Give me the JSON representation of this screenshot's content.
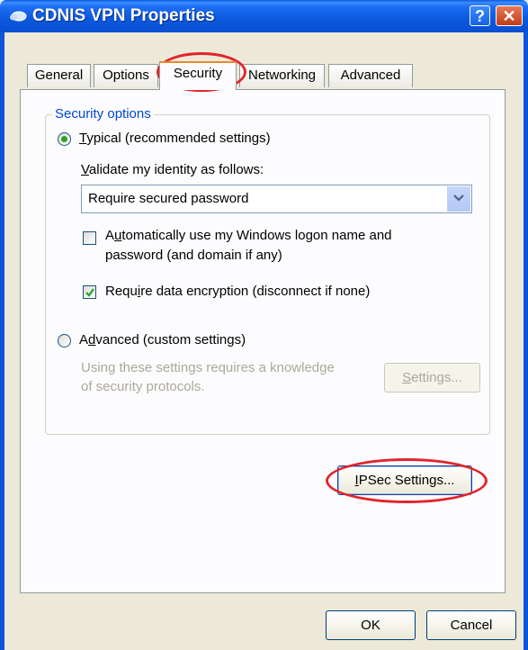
{
  "window": {
    "title": "CDNIS VPN Properties",
    "help": "?",
    "close": "✕"
  },
  "tabs": [
    "General",
    "Options",
    "Security",
    "Networking",
    "Advanced"
  ],
  "security_options": {
    "legend": "Security options",
    "typical": {
      "pre": "",
      "accel": "T",
      "post": "ypical (recommended settings)",
      "selected": true
    },
    "validate": {
      "pre": "",
      "accel": "V",
      "post": "alidate my identity as follows:"
    },
    "identity_select": {
      "value": "Require secured password"
    },
    "auto_logon": {
      "pre": "A",
      "accel": "u",
      "post": "tomatically use my Windows logon name and",
      "line2": "password (and domain if any)",
      "checked": false
    },
    "encrypt": {
      "pre": "Requ",
      "accel": "i",
      "post": "re data encryption (disconnect if none)",
      "checked": true
    },
    "advanced": {
      "pre": "A",
      "accel": "d",
      "post": "vanced (custom settings)",
      "selected": false
    },
    "advanced_note": {
      "line1": "Using these settings requires a knowledge",
      "line2": "of security protocols."
    },
    "settings_button": {
      "pre": "",
      "accel": "S",
      "post": "ettings..."
    }
  },
  "ipsec_button": {
    "pre": "",
    "accel": "I",
    "post": "PSec Settings..."
  },
  "footer": {
    "ok": "OK",
    "cancel": "Cancel"
  }
}
